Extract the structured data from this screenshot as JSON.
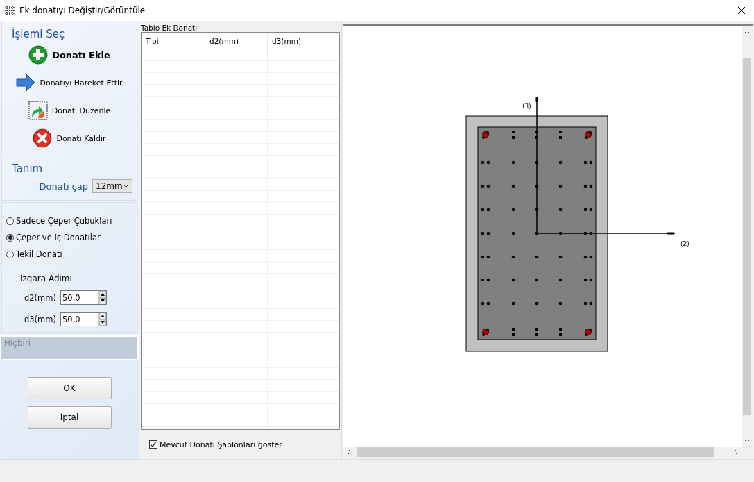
{
  "window": {
    "title": "Ek donatıyı Değiştir/Görüntüle"
  },
  "operations": {
    "heading": "İşlemi Seç",
    "actions": [
      {
        "kind": "add",
        "label": "Donatı Ekle",
        "selected": true
      },
      {
        "kind": "move",
        "label": "Donatıyı Hareket Ettir",
        "selected": false
      },
      {
        "kind": "edit",
        "label": "Donatı Düzenle",
        "selected": false
      },
      {
        "kind": "remove",
        "label": "Donatı Kaldır",
        "selected": false
      }
    ]
  },
  "definition": {
    "heading": "Tanım",
    "diameter_label": "Donatı çap",
    "diameter_value": "12mm"
  },
  "layout_options": [
    {
      "label": "Sadece Çeper Çubukları",
      "selected": false
    },
    {
      "label": "Çeper ve İç Donatılar",
      "selected": true
    },
    {
      "label": "Tekil Donatı",
      "selected": false
    }
  ],
  "grid_step": {
    "heading": "Izgara Adımı",
    "fields": [
      {
        "label": "d2(mm)",
        "value": "50,0"
      },
      {
        "label": "d3(mm)",
        "value": "50,0"
      }
    ]
  },
  "status_box": "Hiçbiri",
  "buttons": [
    "OK",
    "İptal"
  ],
  "table": {
    "title": "Tablo Ek Donatı",
    "columns": [
      "Tipi",
      "d2(mm)",
      "d3(mm)"
    ]
  },
  "show_templates": {
    "label": "Mevcut Donatı Şablonları göster",
    "checked": true
  },
  "drawing": {
    "axis_vertical_label": "(3)",
    "axis_horizontal_label": "(2)"
  }
}
